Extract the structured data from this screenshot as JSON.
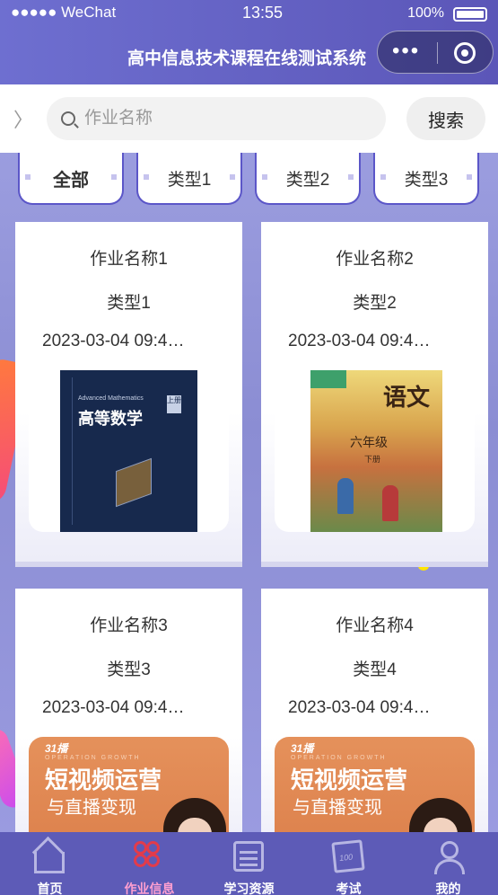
{
  "status_bar": {
    "carrier": "●●●●● WeChat",
    "time": "13:55",
    "battery": "100%"
  },
  "header": {
    "title": "高中信息技术课程在线测试系统"
  },
  "search": {
    "placeholder": "作业名称",
    "button_label": "搜索"
  },
  "tabs": [
    {
      "label": "全部",
      "active": true
    },
    {
      "label": "类型1",
      "active": false
    },
    {
      "label": "类型2",
      "active": false
    },
    {
      "label": "类型3",
      "active": false
    }
  ],
  "cards": [
    {
      "name": "作业名称1",
      "type": "类型1",
      "date": "2023-03-04 09:4…",
      "cover": "math-book-cover"
    },
    {
      "name": "作业名称2",
      "type": "类型2",
      "date": "2023-03-04 09:4…",
      "cover": "chinese-book-cover"
    },
    {
      "name": "作业名称3",
      "type": "类型3",
      "date": "2023-03-04 09:4…",
      "cover": "promo-cover"
    },
    {
      "name": "作业名称4",
      "type": "类型4",
      "date": "2023-03-04 09:4…",
      "cover": "promo-cover"
    }
  ],
  "covers": {
    "math": {
      "title": "高等数学",
      "subtitle": "Advanced Mathematics",
      "tag": "上册"
    },
    "chinese": {
      "title": "语文",
      "grade": "六年级",
      "volume": "下册"
    },
    "promo": {
      "brand": "31播",
      "tagline": "OPERATION GROWTH",
      "headline": "短视频运营",
      "subline": "与直播变现"
    }
  },
  "bottom_nav": [
    {
      "label": "首页",
      "icon": "home-icon",
      "active": false
    },
    {
      "label": "作业信息",
      "icon": "homework-icon",
      "active": true
    },
    {
      "label": "学习资源",
      "icon": "resources-icon",
      "active": false
    },
    {
      "label": "考试",
      "icon": "exam-icon",
      "active": false
    },
    {
      "label": "我的",
      "icon": "user-icon",
      "active": false
    }
  ],
  "colors": {
    "header": "#5b56b8",
    "background": "#8f8fd2",
    "accent_active_nav": "#e23b4b"
  }
}
